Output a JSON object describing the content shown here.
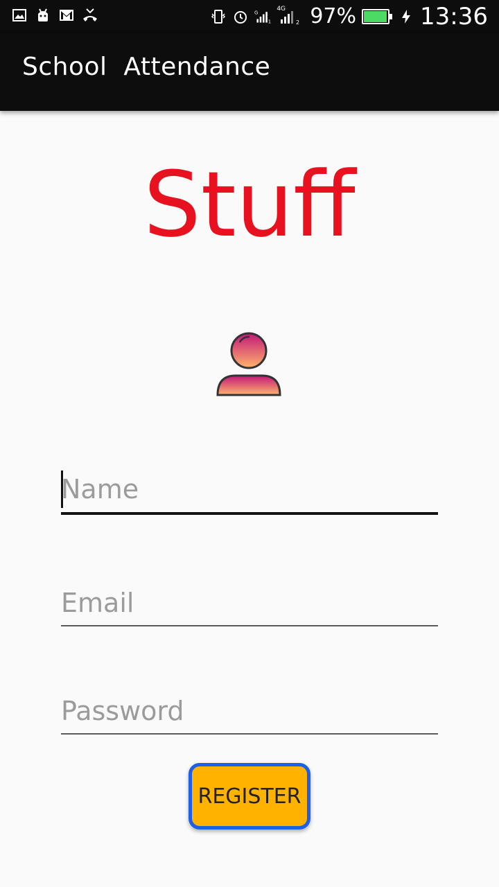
{
  "status_bar": {
    "battery_percent": "97%",
    "time": "13:36",
    "network_label": "4G",
    "battery_level": 0.97,
    "battery_color": "#4cd964",
    "left_icons": [
      "image-icon",
      "android-icon",
      "gmail-icon",
      "missed-call-icon"
    ],
    "right_icons": [
      "vibrate-icon",
      "alarm-icon",
      "signal-icon",
      "signal-4g-icon",
      "battery-icon",
      "charging-icon"
    ]
  },
  "app_bar": {
    "title": "School  Attendance"
  },
  "main": {
    "headline": "Stuff",
    "headline_color": "#e8111f",
    "avatar_icon": "user-avatar-icon"
  },
  "form": {
    "name_placeholder": "Name",
    "email_placeholder": "Email",
    "password_placeholder": "Password",
    "register_label": "REGISTER",
    "button_color": "#ffb300",
    "button_border_color": "#1e5fe8"
  }
}
